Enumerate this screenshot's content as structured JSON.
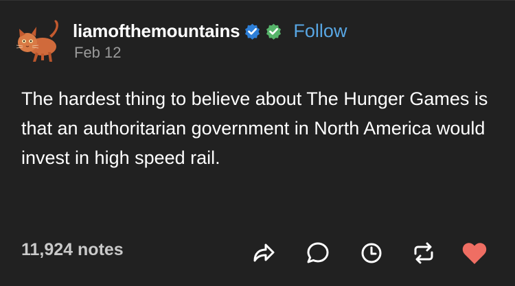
{
  "post": {
    "username": "liamofthemountains",
    "follow_label": "Follow",
    "date": "Feb 12",
    "text": "The hardest thing to believe about The Hunger Games is that an authoritarian government in North America would invest in high speed rail."
  },
  "footer": {
    "notes": "11,924 notes",
    "actions": [
      "share-icon",
      "reply-icon",
      "history-icon",
      "reblog-icon",
      "like-icon"
    ]
  },
  "colors": {
    "background": "#212121",
    "accent_link": "#58a6e3",
    "verified_blue": "#2d7fd8",
    "verified_green": "#56b46a",
    "like": "#ef6e63"
  }
}
